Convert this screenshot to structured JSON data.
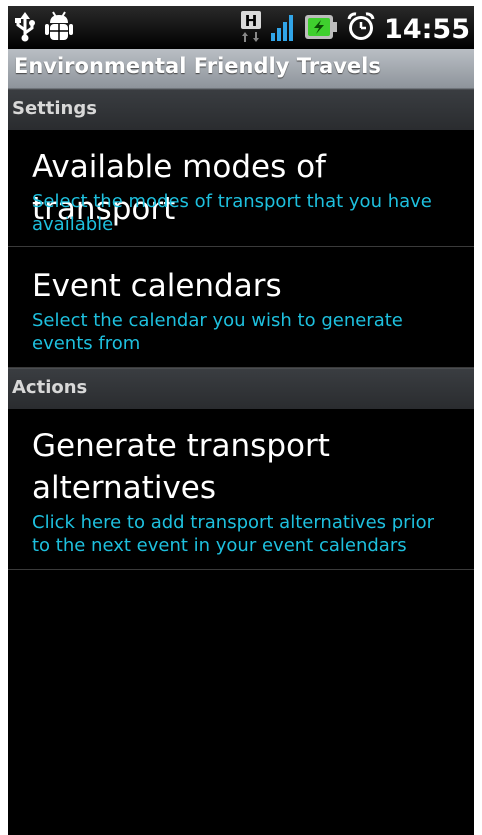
{
  "status_bar": {
    "time": "14:55",
    "icons": [
      "usb-icon",
      "debug-icon",
      "hspa-icon",
      "signal-icon",
      "battery-charging-icon",
      "alarm-icon"
    ],
    "network_label": "H"
  },
  "title_bar": {
    "title": "Environmental Friendly Travels"
  },
  "sections": {
    "settings": {
      "header": "Settings",
      "items": [
        {
          "title": "Available modes of transport",
          "summary": "Select the modes of transport that you have available"
        },
        {
          "title": "Event calendars",
          "summary": "Select the calendar you wish to generate events from"
        }
      ]
    },
    "actions": {
      "header": "Actions",
      "items": [
        {
          "title": "Generate transport alternatives",
          "summary": "Click here to add transport alternatives prior to the next event in your event calendars"
        }
      ]
    }
  },
  "colors": {
    "summary_text": "#1ec0de",
    "background": "#000000",
    "title_bar": "#a3a9af"
  }
}
